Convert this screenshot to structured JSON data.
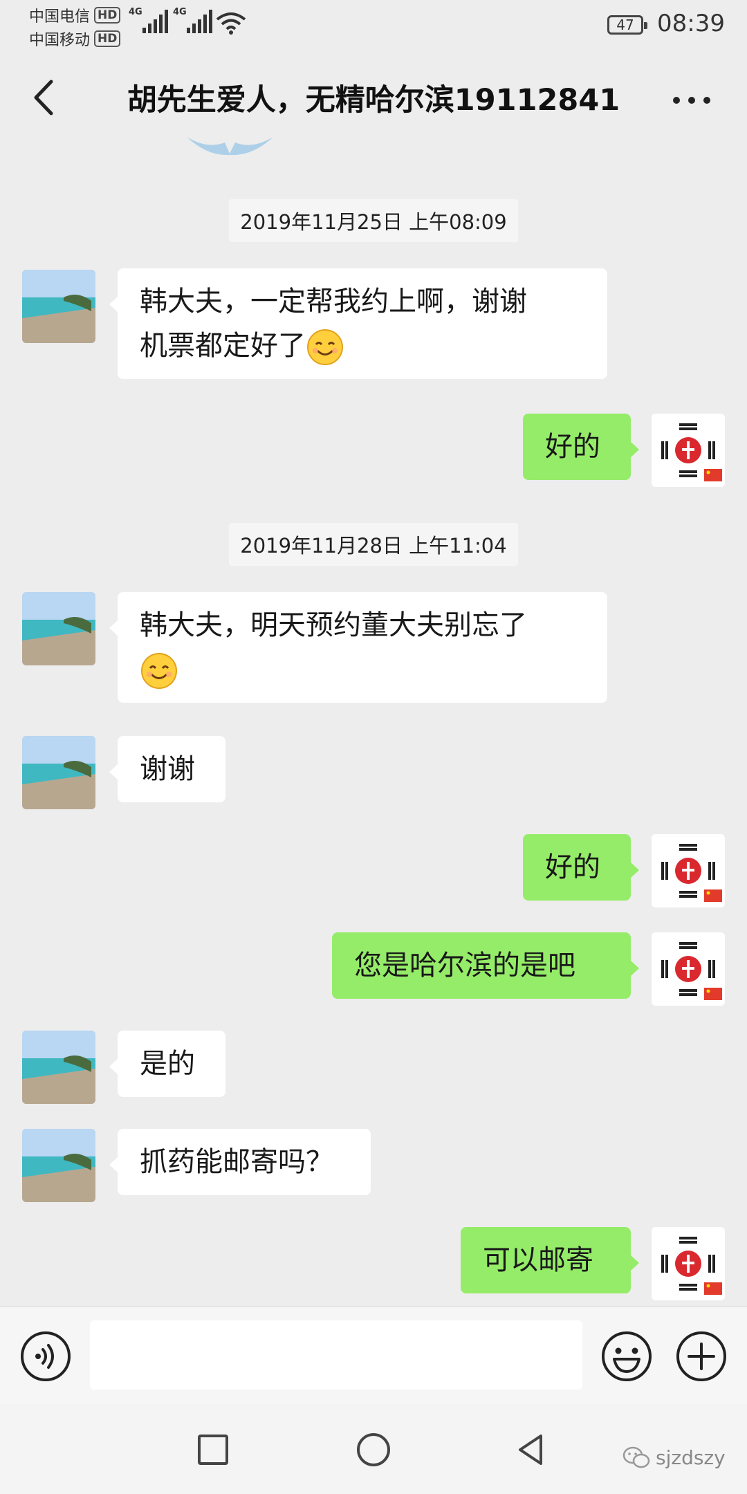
{
  "status_bar": {
    "carrier_1": "中国电信",
    "carrier_2": "中国移动",
    "hd_badge": "HD",
    "network_1": "4G",
    "network_2": "4G",
    "battery": "47",
    "time": "08:39"
  },
  "header": {
    "title": "胡先生爱人，无精哈尔滨19112841",
    "back_icon": "chevron-left-icon",
    "more_icon": "more-dots-icon"
  },
  "messages": [
    {
      "type": "timestamp",
      "text": "2019年11月25日 上午08:09"
    },
    {
      "type": "message",
      "side": "left",
      "lines": [
        "韩大夫，一定帮我约上啊，谢谢",
        "机票都定好了"
      ],
      "emoji": "smile"
    },
    {
      "type": "message",
      "side": "right",
      "lines": [
        "好的"
      ]
    },
    {
      "type": "timestamp",
      "text": "2019年11月28日 上午11:04"
    },
    {
      "type": "message",
      "side": "left",
      "lines": [
        "韩大夫，明天预约董大夫别忘了"
      ],
      "emoji": "smile"
    },
    {
      "type": "message",
      "side": "left",
      "lines": [
        "谢谢"
      ]
    },
    {
      "type": "message",
      "side": "right",
      "lines": [
        "好的"
      ]
    },
    {
      "type": "message",
      "side": "right",
      "lines": [
        "您是哈尔滨的是吧"
      ]
    },
    {
      "type": "message",
      "side": "left",
      "lines": [
        "是的"
      ]
    },
    {
      "type": "message",
      "side": "left",
      "lines": [
        "抓药能邮寄吗？"
      ]
    },
    {
      "type": "message",
      "side": "right",
      "lines": [
        "可以邮寄"
      ]
    }
  ],
  "input_bar": {
    "voice_icon": "voice-icon",
    "emoji_icon": "emoji-icon",
    "plus_icon": "plus-icon",
    "input_value": ""
  },
  "watermark": {
    "text": "sjzdszy"
  },
  "colors": {
    "background": "#ededed",
    "self_bubble": "#95ec69",
    "other_bubble": "#ffffff"
  }
}
